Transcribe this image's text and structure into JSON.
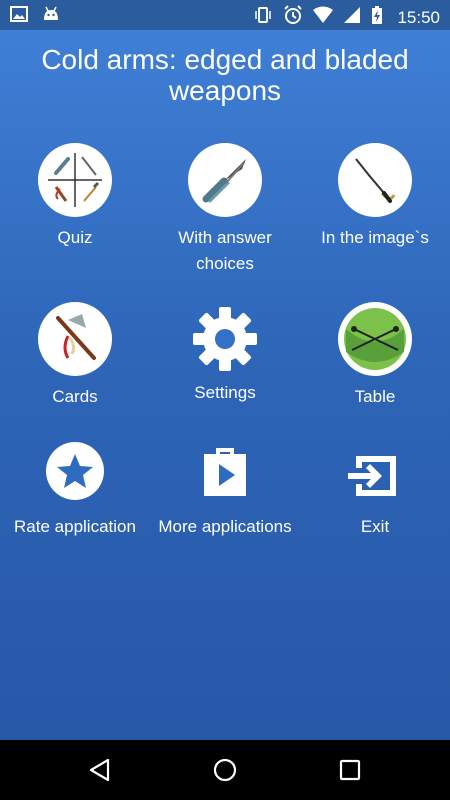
{
  "status_bar": {
    "time": "15:50"
  },
  "header": {
    "title": "Cold arms: edged and bladed weapons"
  },
  "menu": [
    {
      "id": "quiz",
      "label": "Quiz",
      "icon": "weapons-quiz-icon"
    },
    {
      "id": "answer-choices",
      "label": "With answer choices",
      "icon": "butterfly-knife-icon"
    },
    {
      "id": "in-image",
      "label": "In the image`s",
      "icon": "sabre-icon"
    },
    {
      "id": "cards",
      "label": "Cards",
      "icon": "tomahawk-icon"
    },
    {
      "id": "settings",
      "label": "Settings",
      "icon": "gear-icon"
    },
    {
      "id": "table",
      "label": "Table",
      "icon": "crossed-swords-icon"
    },
    {
      "id": "rate",
      "label": "Rate application",
      "icon": "star-icon"
    },
    {
      "id": "more",
      "label": "More applications",
      "icon": "play-store-icon"
    },
    {
      "id": "exit",
      "label": "Exit",
      "icon": "exit-icon"
    }
  ],
  "colors": {
    "background_top": "#3f7fd6",
    "background_bottom": "#2757a8",
    "statusbar": "#2a5c9e"
  }
}
